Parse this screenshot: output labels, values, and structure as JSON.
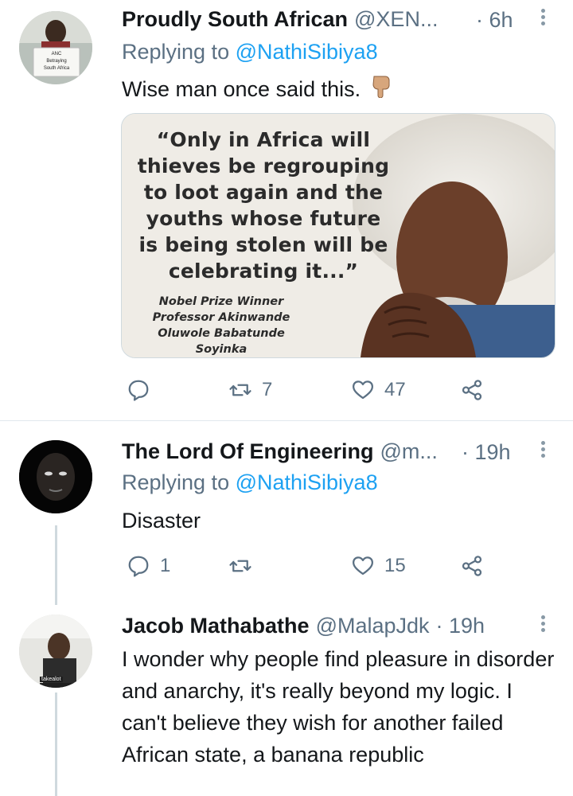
{
  "tweets": [
    {
      "name": "Proudly South African",
      "handle": "@XEN...",
      "time": "· 6h",
      "reply_prefix": "Replying to ",
      "reply_to": "@NathiSibiya8",
      "text": "Wise man once said this.",
      "avatar_sign": [
        "ANC",
        "Betraying",
        "South Africa"
      ],
      "media": {
        "quote": "“Only in Africa will thieves be regrouping to loot again and the youths whose future is being stolen will be celebrating it...”",
        "attribution": [
          "Nobel Prize Winner",
          "Professor Akinwande",
          "Oluwole Babatunde Soyinka"
        ]
      },
      "reply_count": "",
      "retweet_count": "7",
      "like_count": "47"
    },
    {
      "name": "The Lord Of Engineering",
      "handle": "@m...",
      "time": "· 19h",
      "reply_prefix": "Replying to ",
      "reply_to": "@NathiSibiya8",
      "text": "Disaster",
      "reply_count": "1",
      "retweet_count": "",
      "like_count": "15"
    },
    {
      "name": "Jacob Mathabathe",
      "handle": "@MalapJdk",
      "time": "· 19h",
      "text": "I wonder why people find pleasure in disorder and anarchy, it's really beyond my logic. I can't believe they wish for another failed African state, a banana republic",
      "avatar_tag": "takealot"
    }
  ],
  "colors": {
    "link": "#1da1f2",
    "secondary_text": "#5b7083",
    "primary_text": "#14171a",
    "divider": "#e1e8ed"
  },
  "icons": [
    "reply-icon",
    "retweet-icon",
    "like-icon",
    "share-icon",
    "more-icon",
    "pointing-down-emoji"
  ]
}
